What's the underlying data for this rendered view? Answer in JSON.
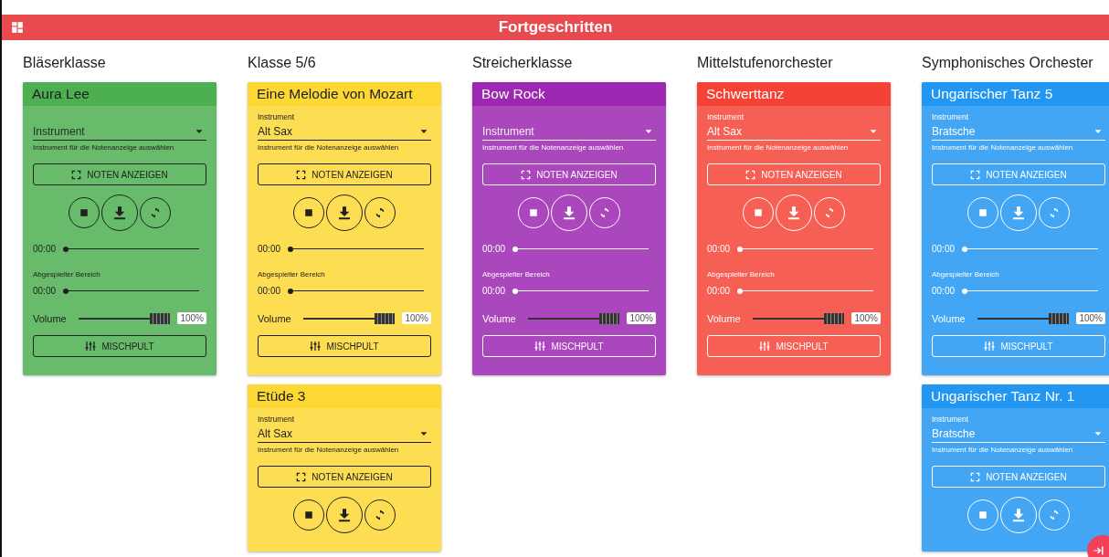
{
  "header": {
    "title": "Fortgeschritten"
  },
  "columns": [
    {
      "title": "Bläserklasse",
      "cards": [
        {
          "title": "Aura Lee",
          "color": "#4caf50",
          "dark_text": true,
          "instrument": {
            "placeholder": "Instrument"
          },
          "helper": "Instrument für die Notenanzeige auswählen",
          "show_button": "NOTEN ANZEIGEN",
          "time": {
            "reading": "00:00",
            "level": 0
          },
          "range": {
            "label": "Abgespielter Bereich",
            "reading": "00:00",
            "level": 0
          },
          "volume": {
            "label": "Volume",
            "level": 1,
            "reading": "100%"
          },
          "mixer_button": "MISCHPULT"
        }
      ]
    },
    {
      "title": "Klasse 5/6",
      "cards": [
        {
          "title": "Eine Melodie von Mozart",
          "color": "#fdd835",
          "dark_text": true,
          "instrument": {
            "label": "Instrument",
            "value": "Alt Sax"
          },
          "helper": "Instrument für die Notenanzeige auswählen",
          "show_button": "NOTEN ANZEIGEN",
          "time": {
            "reading": "00:00",
            "level": 0
          },
          "range": {
            "label": "Abgespielter Bereich",
            "reading": "00:00",
            "level": 0
          },
          "volume": {
            "label": "Volume",
            "level": 1,
            "reading": "100%"
          },
          "mixer_button": "MISCHPULT"
        },
        {
          "title": "Etüde 3",
          "color": "#fdd835",
          "dark_text": true,
          "instrument": {
            "label": "Instrument",
            "value": "Alt Sax"
          },
          "helper": "Instrument für die Notenanzeige auswählen",
          "show_button": "NOTEN ANZEIGEN"
        }
      ]
    },
    {
      "title": "Streicherklasse",
      "cards": [
        {
          "title": "Bow Rock",
          "color": "#9c27b0",
          "dark_text": false,
          "instrument": {
            "placeholder": "Instrument"
          },
          "helper": "Instrument für die Notenanzeige auswählen",
          "show_button": "NOTEN ANZEIGEN",
          "time": {
            "reading": "00:00",
            "level": 0
          },
          "range": {
            "label": "Abgespielter Bereich",
            "reading": "00:00",
            "level": 0
          },
          "volume": {
            "label": "Volume",
            "level": 1,
            "reading": "100%"
          },
          "mixer_button": "MISCHPULT"
        }
      ]
    },
    {
      "title": "Mittelstufenorchester",
      "cards": [
        {
          "title": "Schwerttanz",
          "color": "#f44336",
          "dark_text": false,
          "instrument": {
            "label": "Instrument",
            "value": "Alt Sax"
          },
          "helper": "Instrument für die Notenanzeige auswählen",
          "show_button": "NOTEN ANZEIGEN",
          "time": {
            "reading": "00:00",
            "level": 0
          },
          "range": {
            "label": "Abgespielter Bereich",
            "reading": "00:00",
            "level": 0
          },
          "volume": {
            "label": "Volume",
            "level": 1,
            "reading": "100%"
          },
          "mixer_button": "MISCHPULT"
        }
      ]
    },
    {
      "title": "Symphonisches Orchester",
      "cards": [
        {
          "title": "Ungarischer Tanz 5",
          "color": "#2196f3",
          "dark_text": false,
          "instrument": {
            "label": "Instrument",
            "value": "Bratsche"
          },
          "helper": "Instrument für die Notenanzeige auswählen",
          "show_button": "NOTEN ANZEIGEN",
          "time": {
            "reading": "00:00",
            "level": 0
          },
          "range": {
            "label": "Abgespielter Bereich",
            "reading": "00:00",
            "level": 0
          },
          "volume": {
            "label": "Volume",
            "level": 1,
            "reading": "100%"
          },
          "mixer_button": "MISCHPULT"
        },
        {
          "title": "Ungarischer Tanz Nr. 1",
          "color": "#2196f3",
          "dark_text": false,
          "instrument": {
            "label": "Instrument",
            "value": "Bratsche"
          },
          "helper": "Instrument für die Notenanzeige auswählen",
          "show_button": "NOTEN ANZEIGEN"
        }
      ]
    }
  ]
}
